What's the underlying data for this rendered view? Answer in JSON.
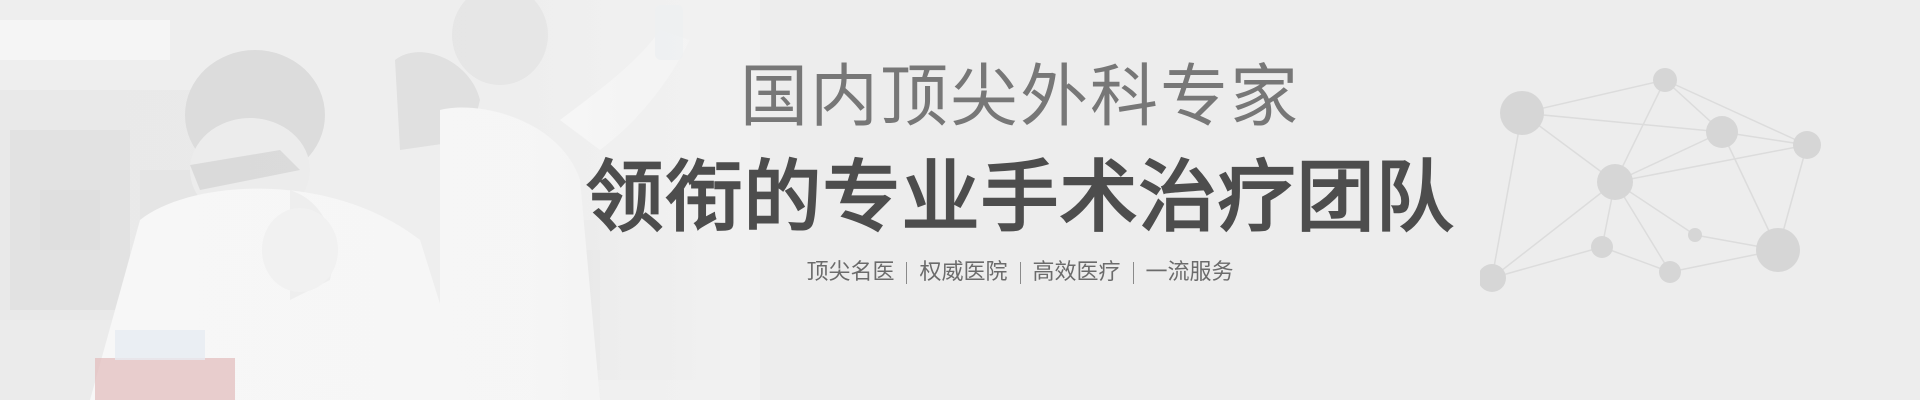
{
  "banner": {
    "headline": "国内顶尖外科专家",
    "subheadline": "领衔的专业手术治疗团队",
    "tagline": [
      "顶尖名医",
      "权威医院",
      "高效医疗",
      "一流服务"
    ]
  },
  "colors": {
    "background": "#ededed",
    "headline": "#6e6e6e",
    "subheadline": "#4d4d4d",
    "tagline": "#6b6b6b",
    "network_nodes": "#d6d6d6",
    "network_lines": "#dcdcdc"
  },
  "icons": {
    "photo": "laboratory-researchers-photo",
    "decoration": "molecule-network-graphic"
  }
}
